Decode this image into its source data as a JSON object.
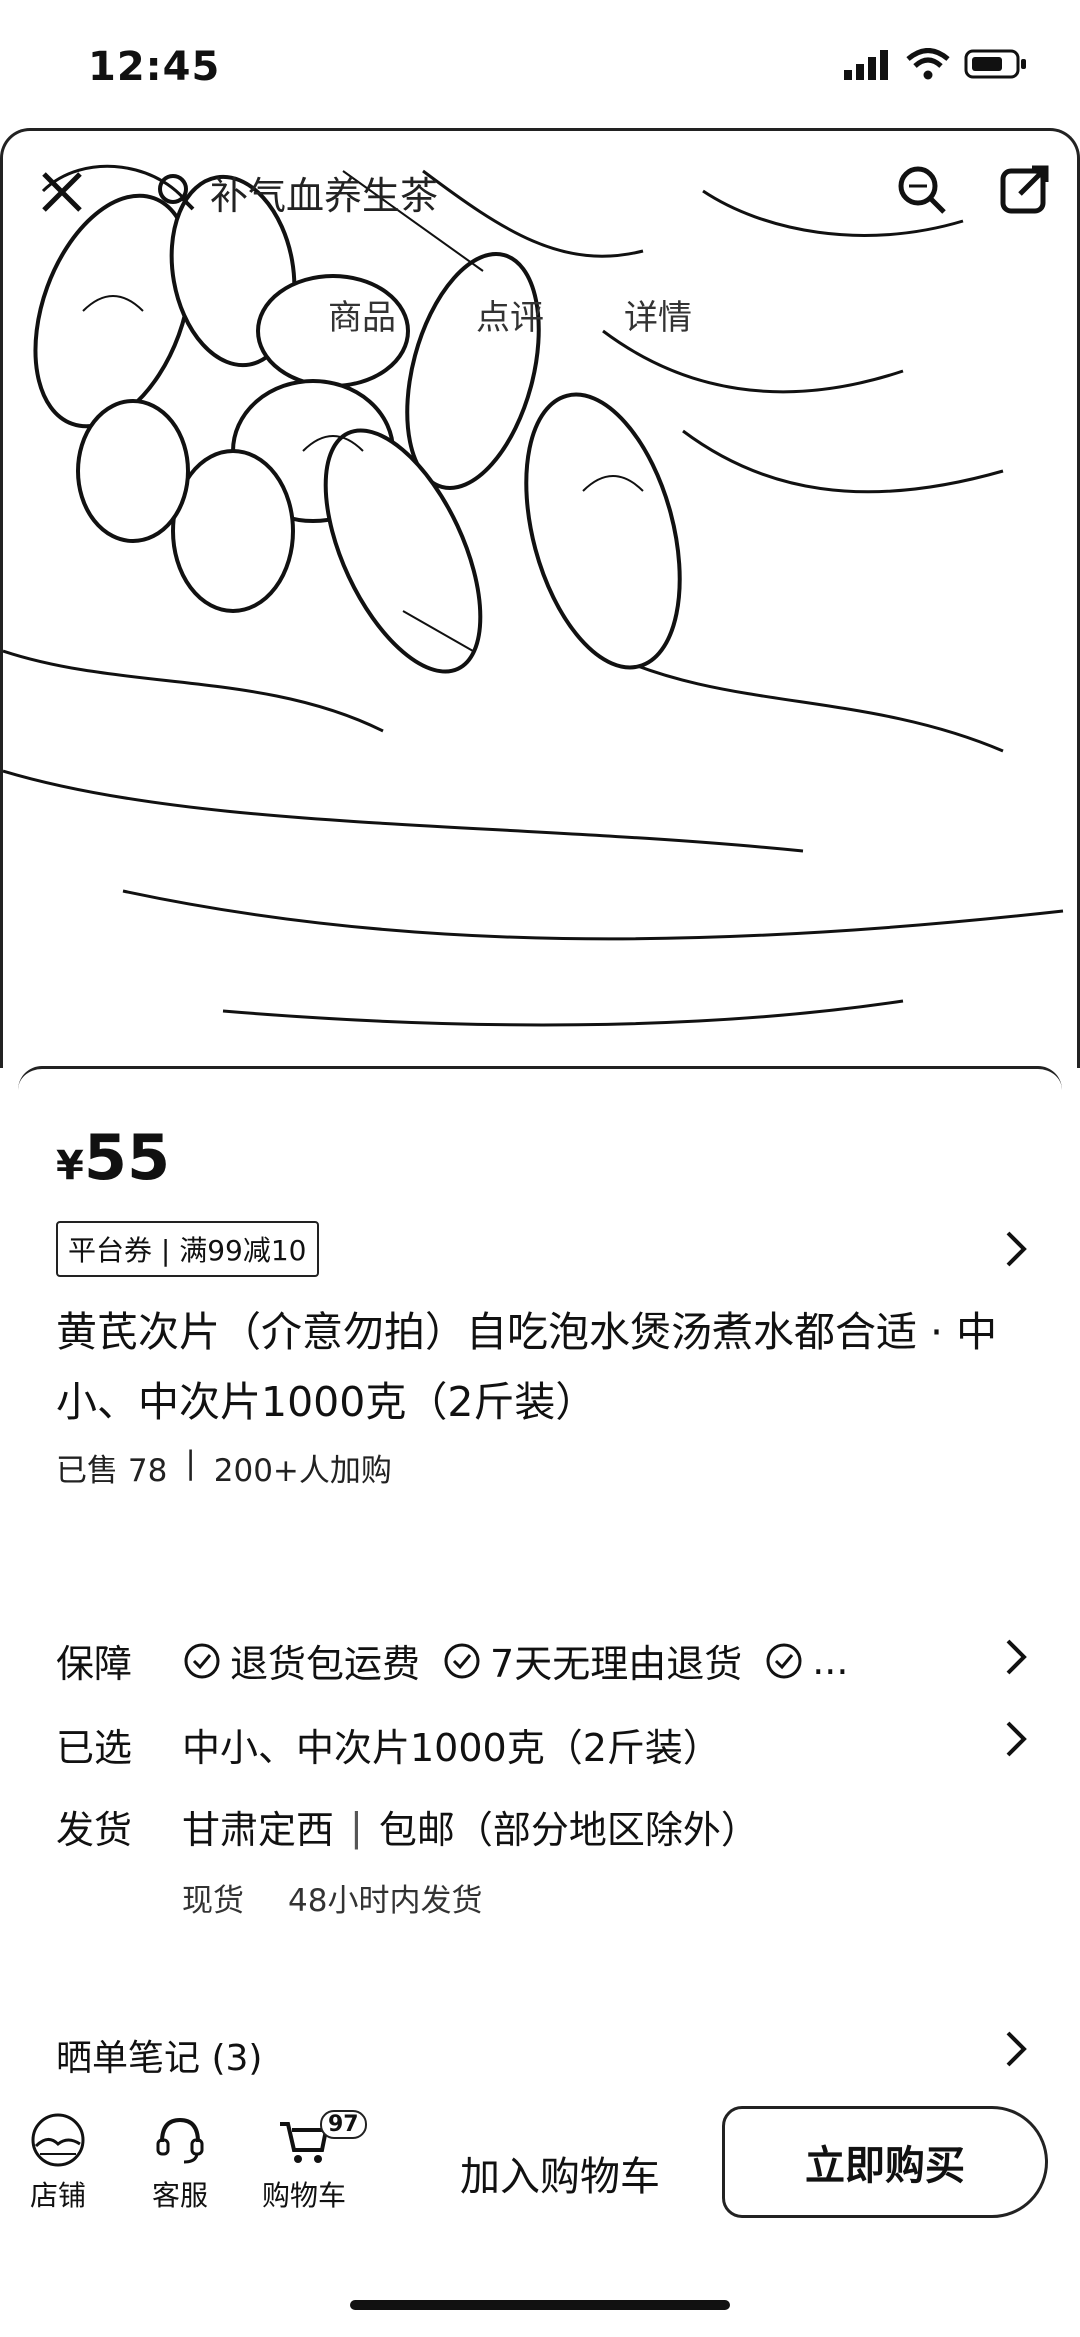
{
  "status": {
    "time": "12:45"
  },
  "search": {
    "query": "补气血养生茶"
  },
  "hero_tabs": [
    "商品",
    "点评",
    "详情"
  ],
  "product": {
    "currency": "¥",
    "price": "55",
    "coupon": "平台券 | 满99减10",
    "title": "黄芪次片（介意勿拍）自吃泡水煲汤煮水都合适 · 中小、中次片1000克（2斤装）",
    "sold": "已售 78",
    "sold_sep": "|",
    "added": "200+人加购"
  },
  "guarantee": {
    "label": "保障",
    "items": [
      "退货包运费",
      "7天无理由退货",
      "..."
    ]
  },
  "selected": {
    "label": "已选",
    "value": "中小、中次片1000克（2斤装）"
  },
  "shipping": {
    "label": "发货",
    "origin": "甘肃定西",
    "sep": "|",
    "policy": "包邮（部分地区除外）",
    "stock": "现货",
    "eta": "48小时内发货"
  },
  "notes": {
    "label": "晒单笔记 (3)"
  },
  "bottom_bar": {
    "shop": "店铺",
    "service": "客服",
    "cart": "购物车",
    "cart_count": "97",
    "add_to_cart": "加入购物车",
    "buy_now": "立即购买"
  }
}
